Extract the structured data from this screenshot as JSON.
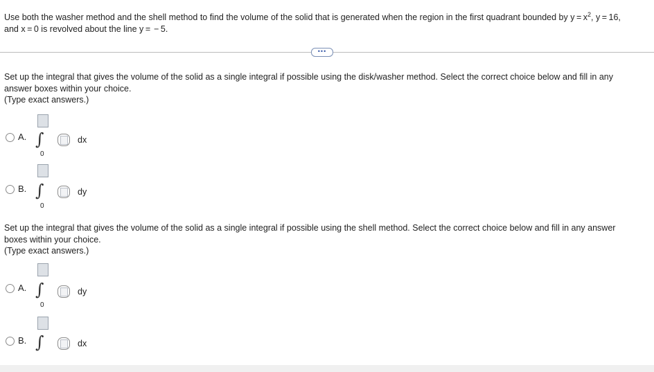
{
  "problem": {
    "text_before": "Use both the washer method and the shell method to find the volume of the solid that is generated when the region in the first quadrant bounded by y = x",
    "exponent": "2",
    "text_after": ", y = 16,",
    "line2": "and x = 0 is revolved about the line y =  − 5."
  },
  "more_button": "•••",
  "washer": {
    "instruction_line1": "Set up the integral that gives the volume of the solid as a single integral if possible using the disk/washer method. Select the correct choice below and fill in any",
    "instruction_line2": "answer boxes within your choice.",
    "instruction_note": "(Type exact answers.)",
    "choices": [
      {
        "letter": "A.",
        "lower": "0",
        "differential": "dx"
      },
      {
        "letter": "B.",
        "lower": "0",
        "differential": "dy"
      }
    ]
  },
  "shell": {
    "instruction_line1": "Set up the integral that gives the volume of the solid as a single integral if possible using the shell method. Select the correct choice below and fill in any answer",
    "instruction_line2": "boxes within your choice.",
    "instruction_note": "(Type exact answers.)",
    "choices": [
      {
        "letter": "A.",
        "lower": "0",
        "differential": "dy"
      },
      {
        "letter": "B.",
        "lower": "",
        "differential": "dx"
      }
    ]
  }
}
